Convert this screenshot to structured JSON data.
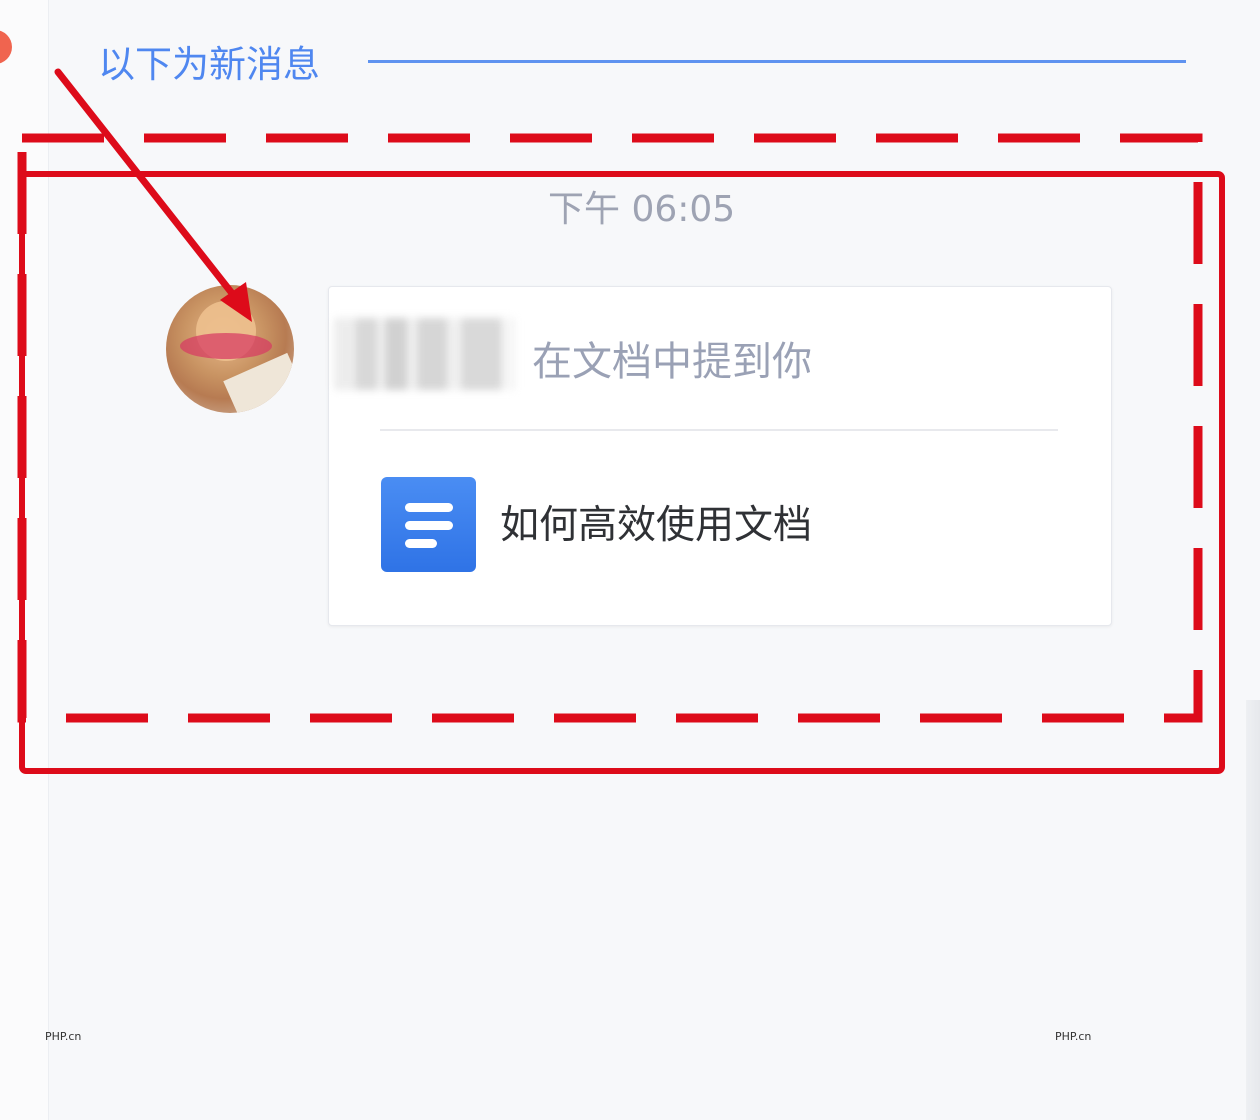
{
  "chat": {
    "new_messages_label": "以下为新消息",
    "timestamp": "下午 06:05",
    "notification": {
      "mention_text": "在文档中提到你",
      "document_title": "如何高效使用文档",
      "document_icon": "document-icon"
    }
  },
  "watermarks": {
    "left": "PHP.cn",
    "right": "PHP.cn"
  },
  "colors": {
    "accent_blue": "#4f87f0",
    "annotation_red": "#dd0b1a",
    "unread_dot": "#f0644f"
  }
}
